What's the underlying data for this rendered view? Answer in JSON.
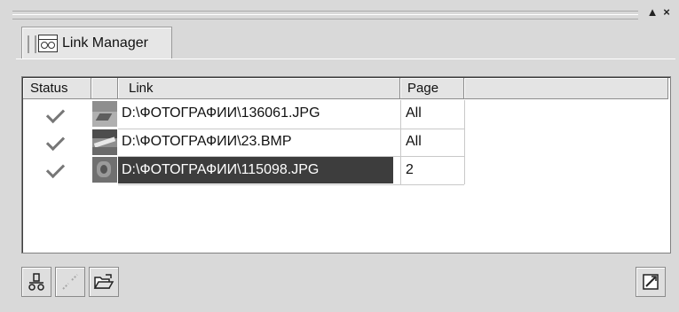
{
  "panel": {
    "tab_label": "Link Manager",
    "pin_glyph": "▲",
    "close_glyph": "×"
  },
  "columns": [
    "Status",
    "",
    "Link",
    "Page"
  ],
  "rows": [
    {
      "status": "linked",
      "link": "D:\\ФОТОГРАФИИ\\136061.JPG",
      "page": "All",
      "selected": false
    },
    {
      "status": "linked",
      "link": "D:\\ФОТОГРАФИИ\\23.BMP",
      "page": "All",
      "selected": false
    },
    {
      "status": "linked",
      "link": "D:\\ФОТОГРАФИИ\\115098.JPG",
      "page": "2",
      "selected": true
    }
  ],
  "toolbar": {
    "relink_icon": "relink-icon",
    "break_link_icon": "break-link-icon",
    "open_folder_icon": "open-folder-icon",
    "options_icon": "options-icon"
  },
  "colors": {
    "selection": "#3d3d3d",
    "panel": "#d9d9d9"
  }
}
